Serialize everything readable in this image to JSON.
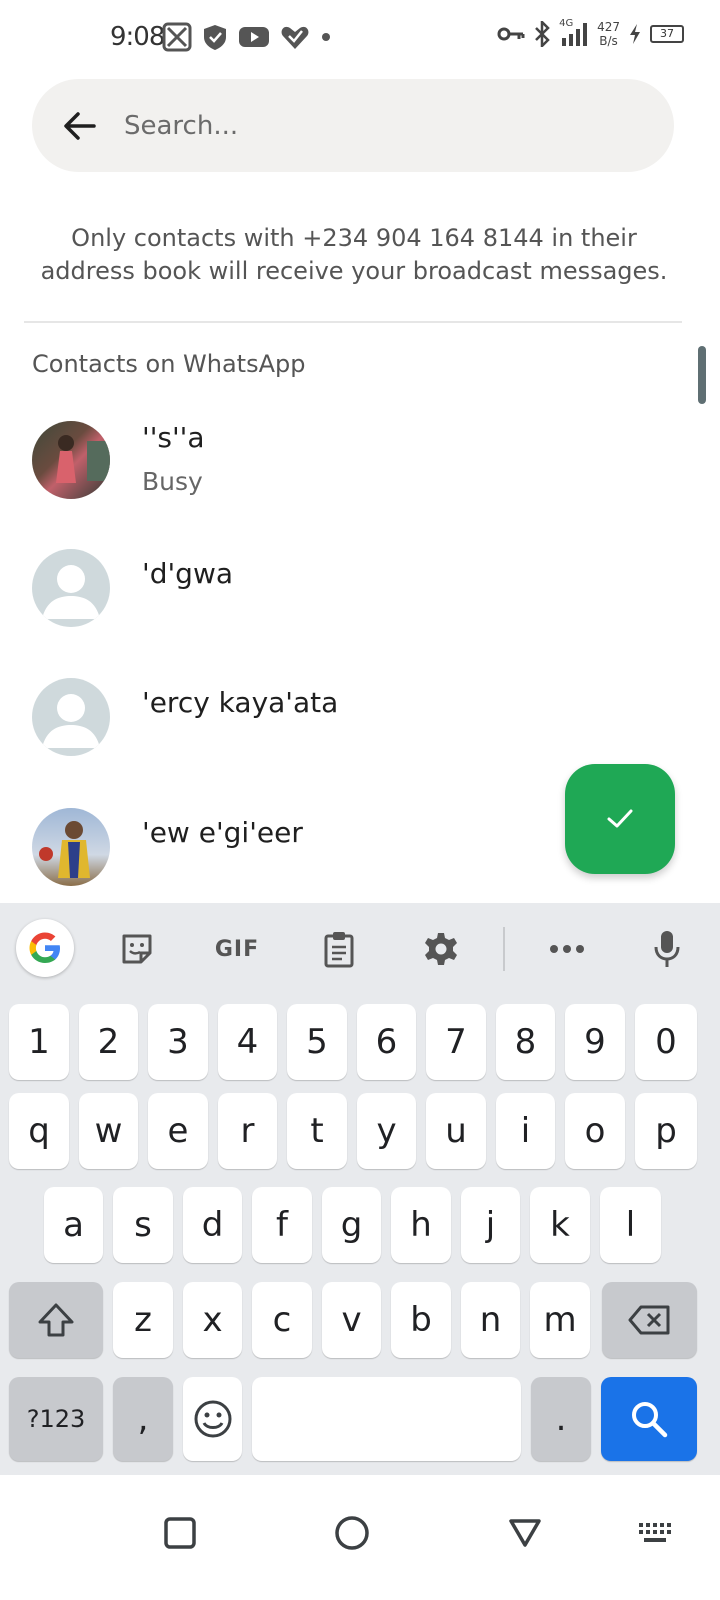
{
  "status_bar": {
    "time": "9:08",
    "network": "4G",
    "speed_value": "427",
    "speed_unit": "B/s",
    "battery": "37"
  },
  "search": {
    "placeholder": "Search..."
  },
  "notice": "Only contacts with +234 904 164 8144 in their address book will receive your broadcast messages.",
  "section_label": "Contacts on WhatsApp",
  "contacts": [
    {
      "name": "''s''a",
      "status": "Busy"
    },
    {
      "name": "'d'gwa",
      "status": ""
    },
    {
      "name": "'ercy kaya'ata",
      "status": ""
    },
    {
      "name": "'ew e'gi'eer",
      "status": ""
    }
  ],
  "fab_icon": "check-icon",
  "keyboard": {
    "toolbar": {
      "gif_label": "GIF"
    },
    "number_row": [
      "1",
      "2",
      "3",
      "4",
      "5",
      "6",
      "7",
      "8",
      "9",
      "0"
    ],
    "row1": [
      "q",
      "w",
      "e",
      "r",
      "t",
      "y",
      "u",
      "i",
      "o",
      "p"
    ],
    "row2": [
      "a",
      "s",
      "d",
      "f",
      "g",
      "h",
      "j",
      "k",
      "l"
    ],
    "row3": [
      "z",
      "x",
      "c",
      "v",
      "b",
      "n",
      "m"
    ],
    "symbols_label": "?123",
    "comma_label": ",",
    "period_label": ".",
    "accent_color": "#1a73e8"
  },
  "colors": {
    "fab": "#1fa855",
    "search_bg": "#f2f1ef"
  }
}
